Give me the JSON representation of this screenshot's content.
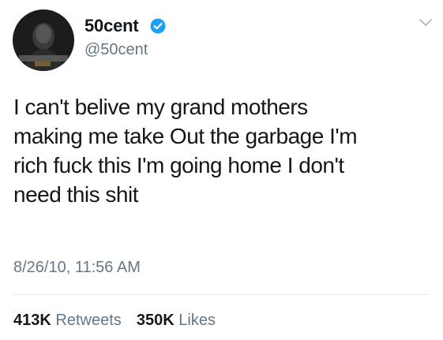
{
  "author": {
    "display_name": "50cent",
    "handle": "@50cent",
    "verified": true,
    "avatar_icon": "profile-photo"
  },
  "tweet": {
    "text": "I can't belive my grand mothers\nmaking me take Out the garbage I'm\nrich fuck this I'm going home I don't\nneed this shit",
    "timestamp": "8/26/10, 11:56 AM"
  },
  "stats": {
    "retweets_count": "413K",
    "retweets_label": "Retweets",
    "likes_count": "350K",
    "likes_label": "Likes"
  },
  "colors": {
    "text": "#14171a",
    "secondary": "#657786",
    "verified_blue": "#1da1f2",
    "divider": "#e6ecf0"
  }
}
